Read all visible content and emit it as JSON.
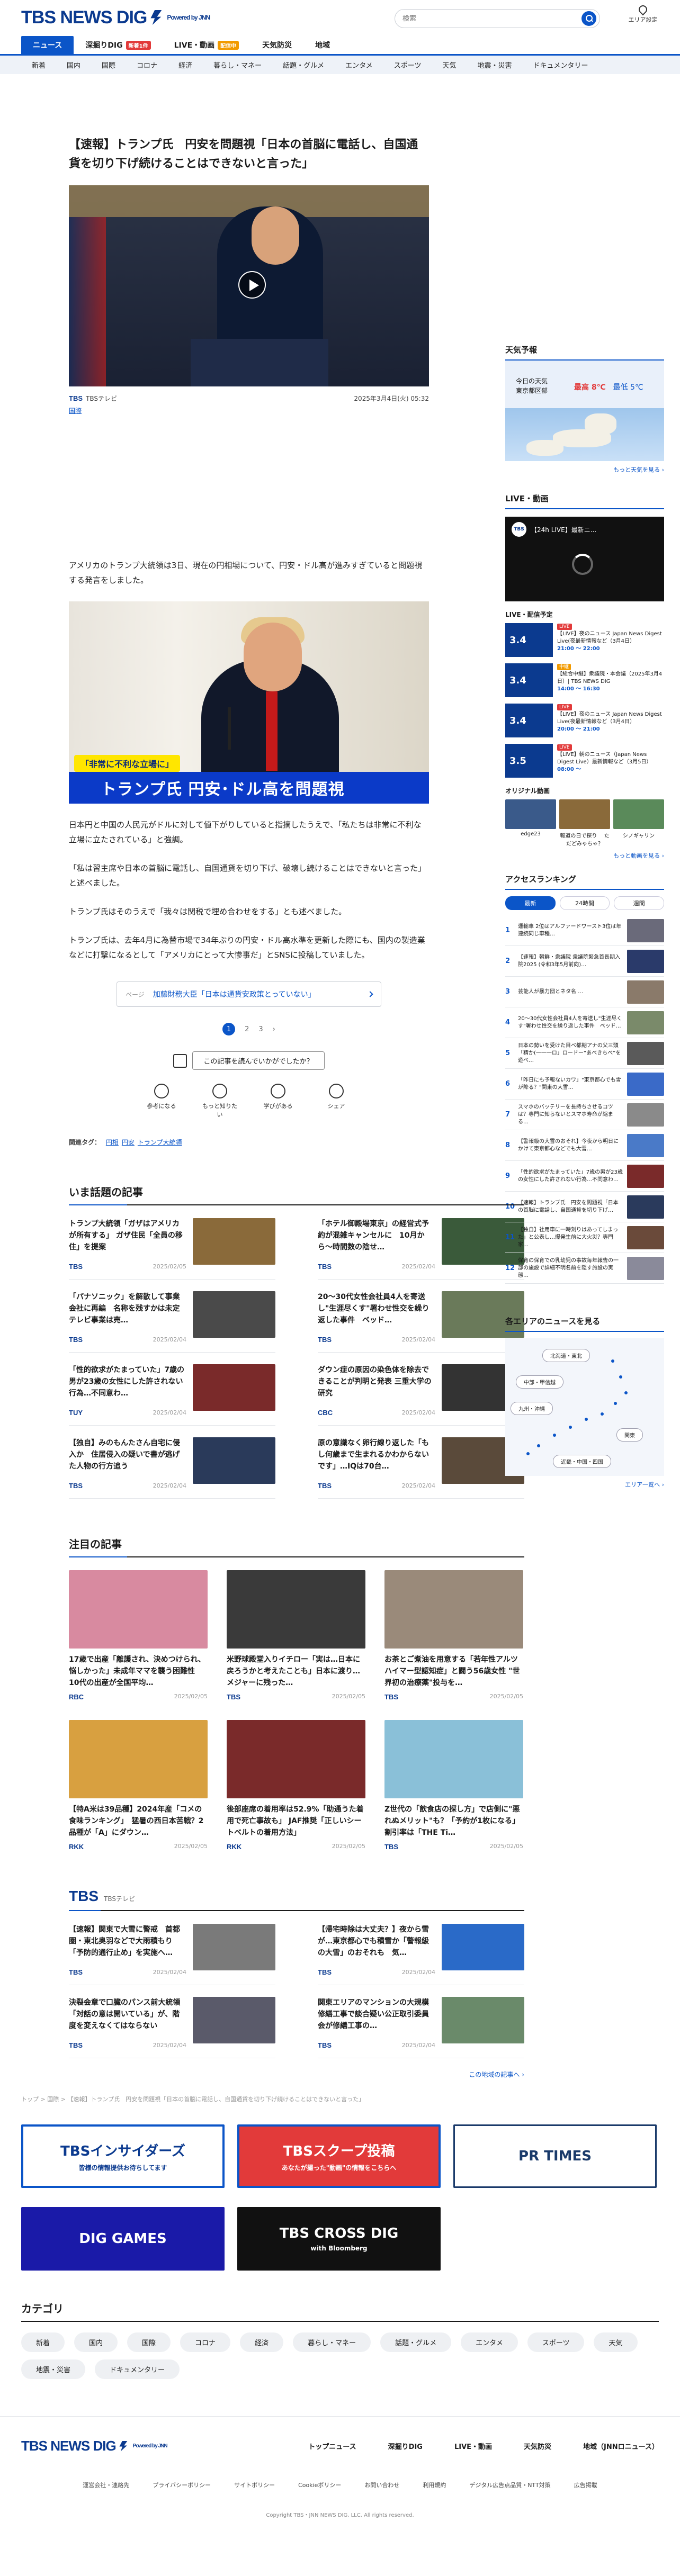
{
  "header": {
    "logo": "TBS NEWS DIG",
    "powered_by": "Powered by JNN",
    "search_placeholder": "検索",
    "area_label": "エリア設定"
  },
  "main_nav": [
    {
      "label": "ニュース",
      "active": true,
      "badge": ""
    },
    {
      "label": "深掘りDIG",
      "active": false,
      "badge": "新着1件"
    },
    {
      "label": "LIVE・動画",
      "active": false,
      "badge": "配信中"
    },
    {
      "label": "天気防災",
      "active": false,
      "badge": ""
    },
    {
      "label": "地域",
      "active": false,
      "badge": ""
    }
  ],
  "category_nav": [
    "新着",
    "国内",
    "国際",
    "コロナ",
    "経済",
    "暮らし・マネー",
    "話題・グルメ",
    "エンタメ",
    "スポーツ",
    "天気",
    "地震・災害",
    "ドキュメンタリー"
  ],
  "article": {
    "headline": "【速報】トランプ氏　円安を問題視「日本の首脳に電話し、自国通貨を切り下げ続けることはできないと言った」",
    "source": "TBSテレビ",
    "date": "2025年3月4日(火) 05:32",
    "category": "国際",
    "para1": "アメリカのトランプ大統領は3日、現在の円相場について、円安・ドル高が進みすぎていると問題視する発言をしました。",
    "caption_small": "「非常に不利な立場に」",
    "caption_big": "トランプ氏 円安･ドル高を問題視",
    "para2": "日本円と中国の人民元がドルに対して値下がりしていると指摘したうえで、「私たちは非常に不利な立場に立たされている」と強調。",
    "para3": "「私は習主席や日本の首脳に電話し、自国通貨を切り下げ、破壊し続けることはできないと言った」と述べました。",
    "para4": "トランプ氏はそのうえで「我々は関税で埋め合わせをする」とも述べました。",
    "para5": "トランプ氏は、去年4月に為替市場で34年ぶりの円安・ドル高水準を更新した際にも、国内の製造業などに打撃になるとして「アメリカにとって大惨事だ」とSNSに投稿していました。",
    "related_label": "ページ",
    "related_text": "加藤財務大臣「日本は通貨安政策とっていない」",
    "pages": [
      "1",
      "2",
      "3"
    ],
    "feedback": "この記事を読んでいかがでしたか？",
    "reactions": [
      "参考になる",
      "もっと知りたい",
      "学びがある",
      "シェア"
    ],
    "tags_label": "関連タグ：",
    "tags": [
      "円相",
      "円安",
      "トランプ大統領"
    ]
  },
  "trending": {
    "title": "いま話題の記事",
    "items": [
      {
        "title": "トランプ大統領「ガザはアメリカが所有する」 ガザ住民「全員の移住」を提案",
        "src": "TBS",
        "date": "2025/02/05",
        "color": "#8a6a3a"
      },
      {
        "title": "「ホテル御殿場東京」の経営式予約が混雑キャンセルに　10月から〜時間数の陰せ…",
        "src": "TBS",
        "date": "2025/02/04",
        "color": "#3a5a3a"
      },
      {
        "title": "「パナソニック」を解散して事業会社に再編　名称を残すかは未定　テレビ事業は売…",
        "src": "TBS",
        "date": "2025/02/04",
        "color": "#4a4a4a"
      },
      {
        "title": "20〜30代女性会社員4人を寄送し\"生涯尽くす\"署わせ性交を繰り返した事件　ベッド…",
        "src": "TBS",
        "date": "2025/02/04",
        "color": "#6a7a5a"
      },
      {
        "title": "「性的欲求がたまっていた」7歳の男が23歳の女性にした許されない行為…不同意わ…",
        "src": "TUY",
        "date": "2025/02/04",
        "color": "#7a2a2a"
      },
      {
        "title": "ダウン症の原因の染色体を除去できることが判明と発表 三重大学の研究",
        "src": "CBC",
        "date": "2025/02/04",
        "color": "#333333"
      },
      {
        "title": "【独自】みのもんたさん自宅に侵入か　住居侵入の疑いで書が逃げた人物の行方追う",
        "src": "TBS",
        "date": "2025/02/04",
        "color": "#2a3a5a"
      },
      {
        "title": "原の意識なく卵行線り返した「もし何歳まで生まれるかわからないです」…IQは70台…",
        "src": "TBS",
        "date": "2025/02/04",
        "color": "#5a4a3a"
      }
    ]
  },
  "featured": {
    "title": "注目の記事",
    "items": [
      {
        "title": "17歳で出産「離護され、決めつけられ、悩しかった」未成年ママを襲う困難性　10代の出産が全国平均…",
        "src": "RBC",
        "date": "2025/02/05",
        "color": "#d88aa0"
      },
      {
        "title": "米野球殿堂入りイチロー「実は…日本に戻ろうかと考えたことも」日本に渡り…メジャーに残った…",
        "src": "TBS",
        "date": "2025/02/05",
        "color": "#3a3a3a"
      },
      {
        "title": "お茶とご煮油を用意する「若年性アルツハイマー型認知症」と闘う56歳女性 \"世界初の治療薬\"投与を…",
        "src": "TBS",
        "date": "2025/02/05",
        "color": "#9a8a7a"
      },
      {
        "title": "【特A米は39品種】2024年産「コメの食味ランキング」　猛暑の西日本苦戦？2品種が「A」にダウン…",
        "src": "RKK",
        "date": "2025/02/05",
        "color": "#d8a040"
      },
      {
        "title": "後部座席の着用率は52.9%「助通うた着用で死亡事故も」 JAF推奨「正しいシートベルトの着用方法」",
        "src": "RKK",
        "date": "2025/02/05",
        "color": "#7a2a2a"
      },
      {
        "title": "Z世代の「飲食店の探し方」で店側に\"悪れぬメリット\"も？「予約が1枚になる」割引率は「THE Ti…",
        "src": "TBS",
        "date": "2025/02/05",
        "color": "#8ac0d8"
      }
    ]
  },
  "tbs_section": {
    "title": "TBS",
    "subtitle": "TBSテレビ",
    "items": [
      {
        "title": "【速報】関東で大雪に警戒　首都圏・東北奥羽などで大雨積もり「予防的通行止め」を実施へ…",
        "date": "2025/02/04",
        "color": "#7a7a7a"
      },
      {
        "title": "【帰宅時除は大丈夫？】夜から雪が…東京都心でも積雪か「警報級の大雪」のおそれも　気…",
        "date": "2025/02/04",
        "color": "#2a6ac8"
      },
      {
        "title": "決裂会章で口臓のパンス前大統領「対話の意は開いている」が、階度を変えなくてはならない",
        "date": "2025/02/04",
        "color": "#5a5a6a"
      },
      {
        "title": "関東エリアのマンションの大規模修繕工事で談合疑い公正取引委員会が修繕工事の…",
        "date": "2025/02/04",
        "color": "#6a8a6a"
      }
    ],
    "more": "この地域の記事へ ›"
  },
  "breadcrumb": "トップ > 国際 > 【速報】トランプ氏　円安を問題視「日本の首脳に電話し、自国通貨を切り下げ続けることはできないと言った」",
  "banners": [
    {
      "label": "TBSインサイダーズ",
      "sub": "皆様の情報提供お待ちしてます"
    },
    {
      "label": "TBSスクープ投稿",
      "sub": "あなたが撮った\"動画\"の情報をこちらへ"
    },
    {
      "label": "PR TIMES",
      "sub": ""
    },
    {
      "label": "DIG GAMES",
      "sub": ""
    },
    {
      "label": "TBS CROSS DIG",
      "sub": "with Bloomberg"
    }
  ],
  "categories": {
    "title": "カテゴリ",
    "items": [
      "新着",
      "国内",
      "国際",
      "コロナ",
      "経済",
      "暮らし・マネー",
      "話題・グルメ",
      "エンタメ",
      "スポーツ",
      "天気",
      "地震・災害",
      "ドキュメンタリー"
    ]
  },
  "footer": {
    "links": [
      "トップニュース",
      "深掘りDIG",
      "LIVE・動画",
      "天気防災",
      "地域（JNNロニュース）"
    ],
    "sub_links": [
      "運営会社・連絡先",
      "プライバシーポリシー",
      "サイトポリシー",
      "Cookieポリシー",
      "お問い合わせ",
      "利用規約",
      "デジタル広告点品質・NTT対策",
      "広告掲載"
    ],
    "copyright": "Copyright TBS・JNN NEWS DIG, LLC. All rights reserved."
  },
  "sidebar": {
    "weather_title": "天気予報",
    "weather_label": "今日の天気",
    "weather_loc": "東京都区部",
    "weather_hi": "最高 8℃",
    "weather_lo": "最低 5℃",
    "weather_more": "もっと天気を見る ›",
    "live_title": "LIVE・動画",
    "live_video_title": "【24h LIVE】最新ニ...",
    "schedule_title": "LIVE・配信予定",
    "schedule": [
      {
        "date": "3.4",
        "title": "【LIVE】夜のニュース Japan News Digest Live(夜最新情報など（3月4日）",
        "time": "21:00 ～ 22:00",
        "label": "LIVE",
        "lcolor": "#e23a3a"
      },
      {
        "date": "3.4",
        "title": "【総合中継】衆議院・本会議（2025年3月4日）| TBS NEWS DIG",
        "time": "14:00 ～ 16:30",
        "label": "中継",
        "lcolor": "#f29a00"
      },
      {
        "date": "3.4",
        "title": "【LIVE】夜のニュース Japan News Digest Live(夜最新情報など（3月4日）",
        "time": "20:00 ～ 21:00",
        "label": "LIVE",
        "lcolor": "#e23a3a"
      },
      {
        "date": "3.5",
        "title": "【LIVE】朝のニュース（Japan News Digest Live）最新情報など（3月5日）",
        "time": "08:00 ～",
        "label": "LIVE",
        "lcolor": "#e23a3a"
      }
    ],
    "orig_title": "オリジナル動画",
    "orig": [
      {
        "label": "edge23",
        "color": "#3a5a8a"
      },
      {
        "label": "報道の日で探り 　ただどみゃちゃ？",
        "color": "#8a6a3a"
      },
      {
        "label": "シノギャリン",
        "color": "#5a8a5a"
      }
    ],
    "orig_more": "もっと動画を見る ›",
    "rank_title": "アクセスランキング",
    "rank_tabs": [
      "最新",
      "24時間",
      "週間"
    ],
    "rank": [
      {
        "t": "運輸車 2位はアルファードワースト3位は年連続同じ車種…",
        "c": "#6a6a7a"
      },
      {
        "t": "【速報】朝鮮・衆議院 衆議院緊急首長期入院2025 (令和3年5月前向)…",
        "c": "#2a3a6a"
      },
      {
        "t": "芸能人が暴力団とネタ名 …",
        "c": "#8a7a6a"
      },
      {
        "t": "20〜30代女性会社員4人を寄送し\"生涯尽くす\"署わせ性交を繰り返した事件　ベッド…",
        "c": "#7a8a6a"
      },
      {
        "t": "日本の勢いを受けた目べ都期アナの父三頭「精か(一一一ロ」ロードー“あべきちべ”を遊べ…",
        "c": "#5a5a5a"
      },
      {
        "t": "「昨日にも予報ないカワ」\"東京都心でも雪が降る？\"関東の大雪…",
        "c": "#3a6ac8"
      },
      {
        "t": "スマホのバッテリーを長持ちさせるコツは？専門に知らないとスマホ寿命が縮まる…",
        "c": "#8a8a8a"
      },
      {
        "t": "【警報級の大雪のおそれ】今夜から明日にかけて東京都心などでも大雪…",
        "c": "#4a7ac8"
      },
      {
        "t": "「性的欲求がたまっていた」7歳の男が23歳の女性にした許されない行為…不同意わ…",
        "c": "#7a2a2a"
      },
      {
        "t": "【速報】トランプ氏　円安を問題視「日本の首脳に電話し、自国通貨を切り下げ…",
        "c": "#2a3a5c"
      },
      {
        "t": "【独自】社用車に一時刻りはあってしまった」と公表し…爆発生前に大火災？専門家…",
        "c": "#6a4a3a"
      },
      {
        "t": "保育の保育での乳幼児の事故毎年報告の一部の施設で詳細不明名前を隠す施設の実態…",
        "c": "#8a8a9a"
      }
    ],
    "area_title": "各エリアのニュースを見る",
    "area_names": [
      "北海道・東北",
      "中部・甲信越",
      "九州・沖縄",
      "関東",
      "近畿・中国・四国"
    ],
    "area_more": "エリア一覧へ ›"
  }
}
